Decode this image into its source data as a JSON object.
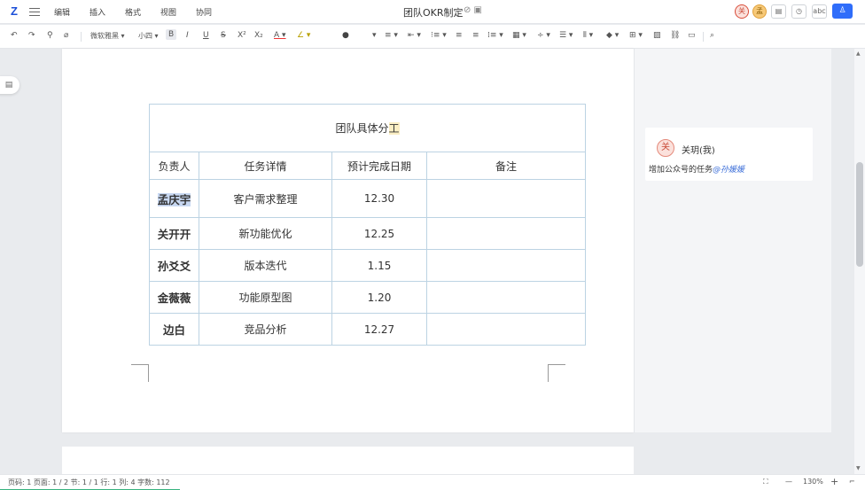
{
  "app": {
    "logo": "Z",
    "menu": [
      "编辑",
      "插入",
      "格式",
      "视图",
      "协同"
    ],
    "doc_title": "团队OKR制定",
    "title_icons": "⊘ ▣",
    "collaborators": [
      "关",
      "孟"
    ],
    "header_buttons": [
      "▤",
      "◷",
      "abc"
    ],
    "share_icon": "♙"
  },
  "toolbar": {
    "undo": "↶",
    "redo": "↷",
    "format_painter": "⚲",
    "clear_format": "⌀",
    "font_family": "微软雅黑 ▾",
    "font_size": "小四 ▾",
    "bold": "B",
    "italic": "I",
    "underline": "U",
    "strike": "S",
    "superscript": "X²",
    "subscript": "X₂",
    "font_color": "A ▾",
    "highlight": "∠ ▾",
    "text_style": "●",
    "align": "≡ ▾",
    "indent1": "⇤ ▾",
    "list1": "⁝≡ ▾",
    "list2": "≡",
    "list3": "≡",
    "list4": "⁞≡ ▾",
    "table": "▦ ▾",
    "divider": "÷ ▾",
    "paragraph": "☰ ▾",
    "column": "⫴ ▾",
    "fill": "◆ ▾",
    "border": "⊞ ▾",
    "image": "▨",
    "link": "⛓",
    "comment": "▭",
    "search": "⌕"
  },
  "outline_toggle": "▤",
  "table": {
    "title_main": "团队具体分",
    "title_highlight": "工",
    "headers": [
      "负责人",
      "任务详情",
      "预计完成日期",
      "备注"
    ],
    "rows": [
      {
        "name": "孟庆宇",
        "task": "客户需求整理",
        "date": "12.30",
        "note": ""
      },
      {
        "name": "关开开",
        "task": "新功能优化",
        "date": "12.25",
        "note": ""
      },
      {
        "name": "孙爻爻",
        "task": "版本迭代",
        "date": "1.15",
        "note": ""
      },
      {
        "name": "金薇薇",
        "task": "功能原型图",
        "date": "1.20",
        "note": ""
      },
      {
        "name": "边白",
        "task": "竞品分析",
        "date": "12.27",
        "note": ""
      }
    ]
  },
  "comment": {
    "avatar": "关",
    "author": "关玥(我)",
    "text": "增加公众号的任务",
    "mention": "@孙媛媛"
  },
  "status": {
    "text": "页码: 1  页面: 1 / 2    节: 1 / 1  行: 1  列: 4  字数: 112",
    "fit_icon": "⛶",
    "zoom_out": "—",
    "zoom": "130%",
    "zoom_in": "+",
    "corner": "⌐"
  }
}
